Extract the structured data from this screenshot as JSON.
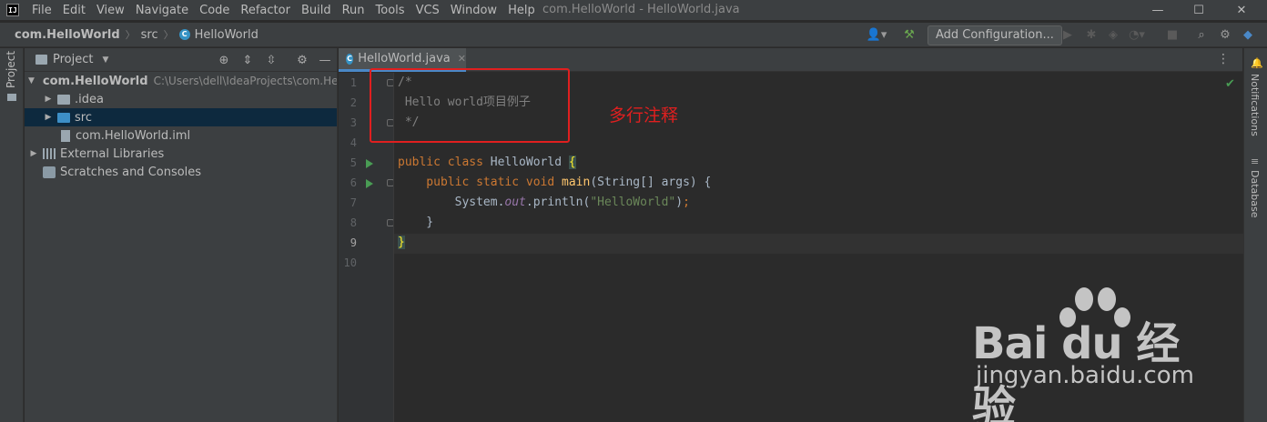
{
  "app": {
    "logo_text": "IJ",
    "window_title": "com.HelloWorld - HelloWorld.java"
  },
  "menu": [
    "File",
    "Edit",
    "View",
    "Navigate",
    "Code",
    "Refactor",
    "Build",
    "Run",
    "Tools",
    "VCS",
    "Window",
    "Help"
  ],
  "window_controls": {
    "minimize": "—",
    "maximize": "☐",
    "close": "✕"
  },
  "breadcrumb": {
    "project": "com.HelloWorld",
    "folder": "src",
    "file": "HelloWorld"
  },
  "toolbar": {
    "add_configuration": "Add Configuration..."
  },
  "left_stripe": {
    "project_label": "Project"
  },
  "project_panel": {
    "title": "Project",
    "tree": {
      "root": {
        "name": "com.HelloWorld",
        "path": "C:\\Users\\dell\\IdeaProjects\\com.He"
      },
      "idea": ".idea",
      "src": "src",
      "iml": "com.HelloWorld.iml",
      "external": "External Libraries",
      "scratches": "Scratches and Consoles"
    }
  },
  "editor": {
    "tab_label": "HelloWorld.java",
    "line_numbers": [
      "1",
      "2",
      "3",
      "4",
      "5",
      "6",
      "7",
      "8",
      "9",
      "10"
    ],
    "current_line": 9,
    "code": {
      "l1": "/*",
      "l2": " Hello world项目例子",
      "l3": " */",
      "l5_kw": "public class ",
      "l5_name": "HelloWorld ",
      "l5_brace": "{",
      "l6_kw": "    public static void ",
      "l6_fn": "main",
      "l6_rest": "(String[] args) {",
      "l7_pre": "        System.",
      "l7_field": "out",
      "l7_call": ".println(",
      "l7_str": "\"HelloWorld\"",
      "l7_end": ")",
      "l7_semi": ";",
      "l8": "    }",
      "l9": "}"
    }
  },
  "annotation": {
    "label": "多行注释",
    "color": "#e01f1f"
  },
  "right_stripe": {
    "notifications": "Notifications",
    "database": "Database"
  },
  "watermark": {
    "brand": "Bai du 经验",
    "url": "jingyan.baidu.com"
  },
  "colors": {
    "keyword": "#cc7832",
    "function": "#ffc66d",
    "string": "#6a8759",
    "comment": "#808080",
    "accent": "#4a88c7"
  }
}
